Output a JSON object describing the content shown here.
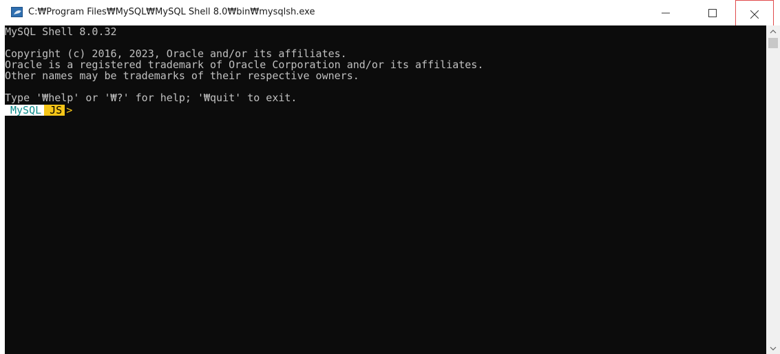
{
  "window": {
    "title": "C:₩Program Files₩MySQL₩MySQL Shell 8.0₩bin₩mysqlsh.exe",
    "controls": {
      "minimize_icon": "minimize-icon",
      "maximize_icon": "maximize-icon",
      "close_icon": "close-icon"
    }
  },
  "console": {
    "lines": [
      "MySQL Shell 8.0.32",
      "",
      "Copyright (c) 2016, 2023, Oracle and/or its affiliates.",
      "Oracle is a registered trademark of Oracle Corporation and/or its affiliates.",
      "Other names may be trademarks of their respective owners.",
      "",
      "Type '₩help' or '₩?' for help; '₩quit' to exit."
    ],
    "prompt": {
      "mysql_segment": "MySQL",
      "js_segment": "JS",
      "arrow": ">"
    }
  },
  "colors": {
    "console_background": "#0c0c0c",
    "console_text": "#c0c0c0",
    "prompt_js_yellow": "#f5c518",
    "prompt_mysql_teal": "#0a8a8a",
    "close_highlight": "#e0494a"
  }
}
